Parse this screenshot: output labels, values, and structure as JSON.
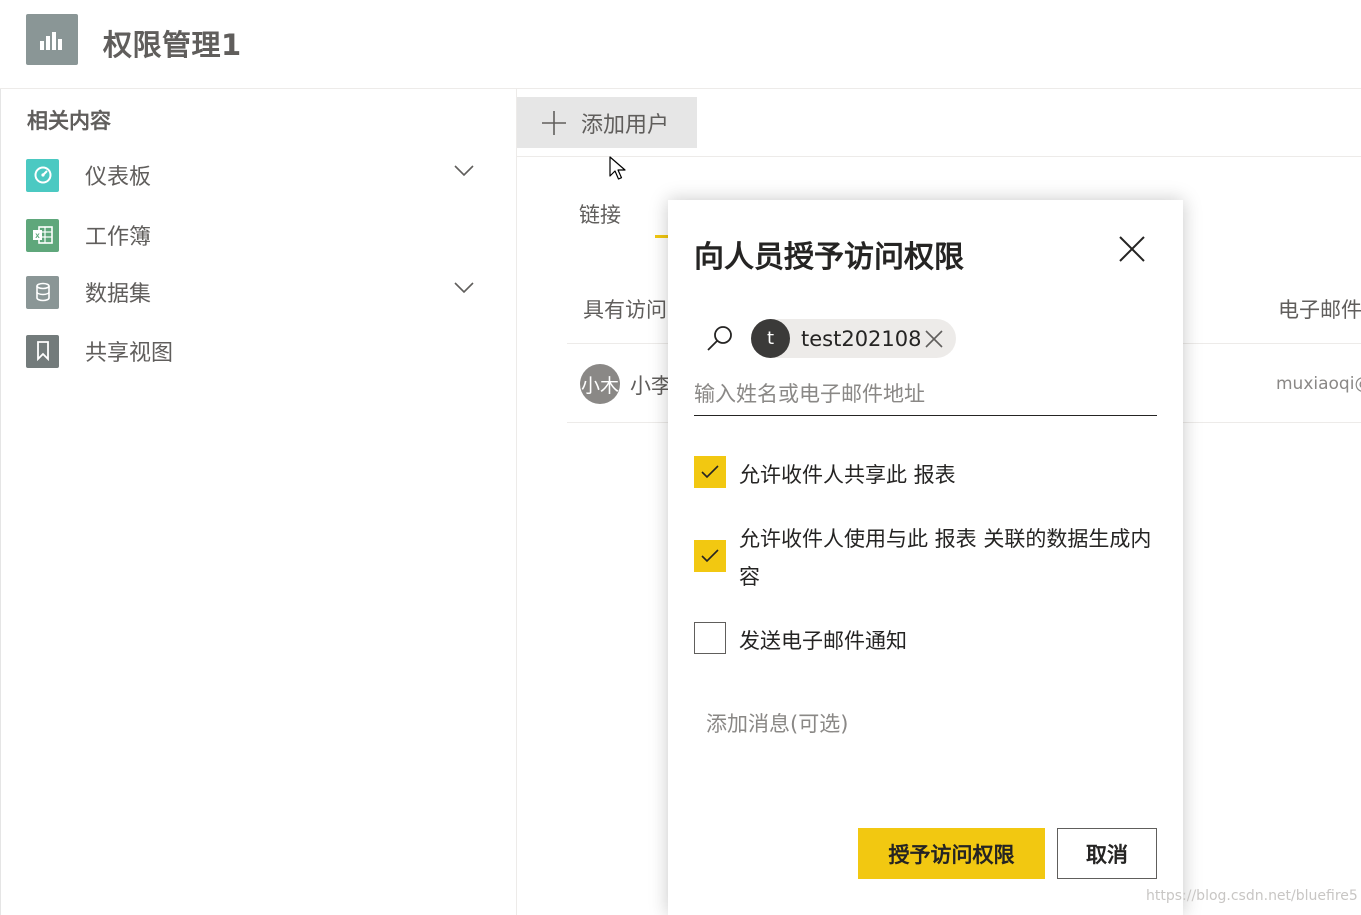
{
  "header": {
    "title": "权限管理1",
    "icon": "bar-chart-icon"
  },
  "sidebar": {
    "heading": "相关内容",
    "items": [
      {
        "label": "仪表板",
        "icon": "dashboard-icon",
        "color": "#4bc9c2",
        "expandable": true
      },
      {
        "label": "工作簿",
        "icon": "excel-icon",
        "color": "#5fa77b",
        "expandable": false
      },
      {
        "label": "数据集",
        "icon": "database-icon",
        "color": "#8a9696",
        "expandable": true
      },
      {
        "label": "共享视图",
        "icon": "bookmark-icon",
        "color": "#737b7b",
        "expandable": false
      }
    ]
  },
  "main": {
    "add_user_label": "添加用户",
    "tabs": [
      {
        "label": "链接"
      }
    ],
    "columns": {
      "access": "具有访问",
      "email": "电子邮件"
    },
    "rows": [
      {
        "avatar": "小木",
        "name": "小李",
        "email": "muxiaoqi@"
      }
    ]
  },
  "dialog": {
    "title": "向人员授予访问权限",
    "chip": {
      "avatar": "t",
      "label": "test202108"
    },
    "people_placeholder": "输入姓名或电子邮件地址",
    "options": [
      {
        "label": "允许收件人共享此 报表",
        "checked": true
      },
      {
        "label": "允许收件人使用与此 报表 关联的数据生成内容",
        "checked": true
      },
      {
        "label": "发送电子邮件通知",
        "checked": false
      }
    ],
    "message_placeholder": "添加消息(可选)",
    "grant_label": "授予访问权限",
    "cancel_label": "取消"
  },
  "watermark": "https://blog.csdn.net/bluefire5",
  "colors": {
    "accent": "#f2c811",
    "text": "#252423",
    "muted": "#605e5c"
  }
}
